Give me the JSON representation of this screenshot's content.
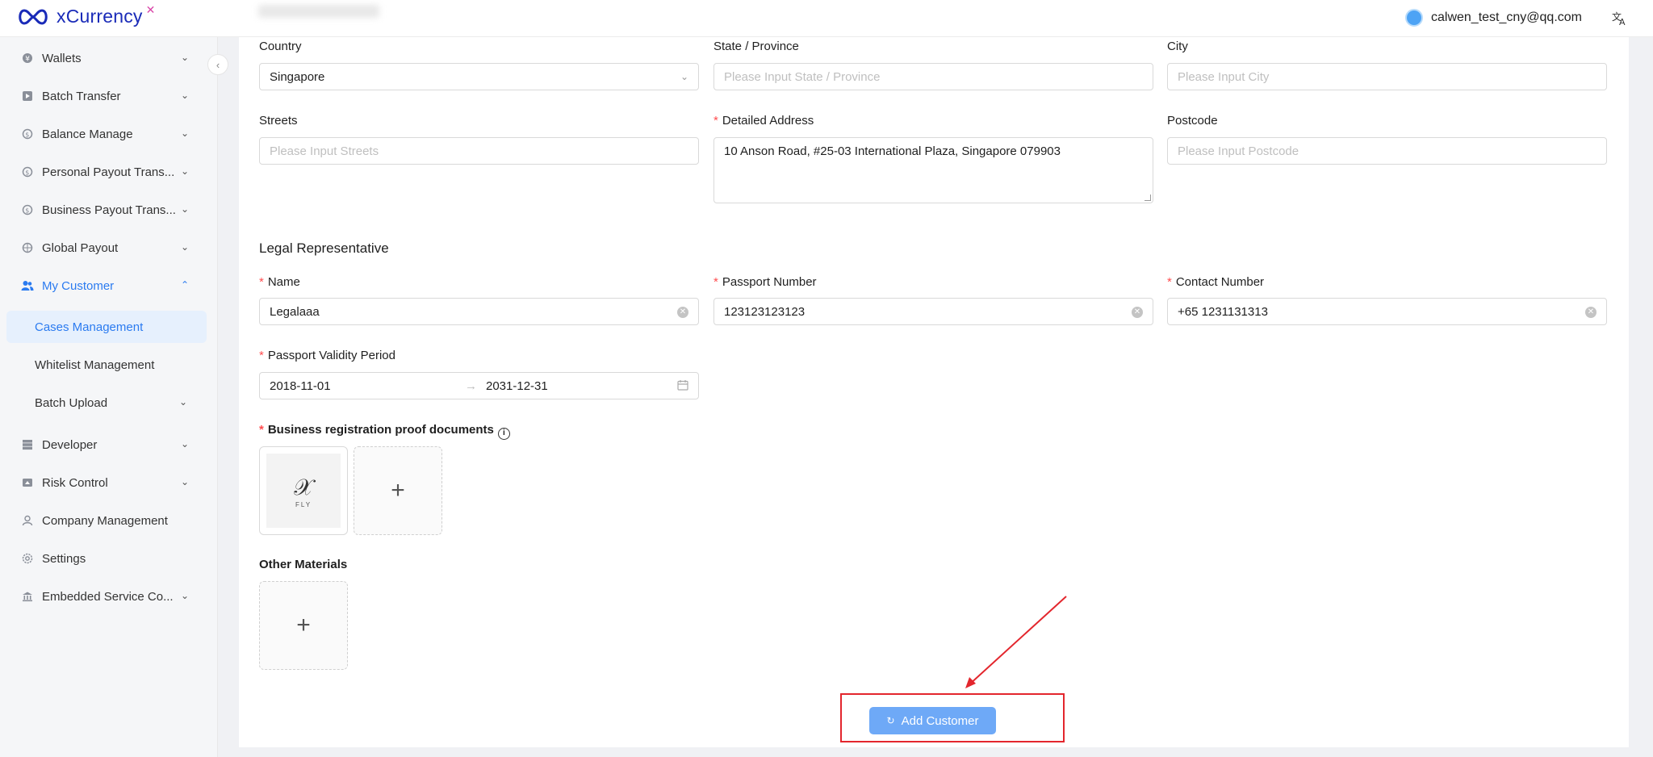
{
  "brand": {
    "name": "xCurrency"
  },
  "header": {
    "user_email": "calwen_test_cny@qq.com"
  },
  "sidebar": {
    "items": [
      {
        "label": "Wallets"
      },
      {
        "label": "Batch Transfer"
      },
      {
        "label": "Balance Manage"
      },
      {
        "label": "Personal Payout Trans..."
      },
      {
        "label": "Business Payout Trans..."
      },
      {
        "label": "Global Payout"
      },
      {
        "label": "My Customer"
      },
      {
        "label": "Cases Management"
      },
      {
        "label": "Whitelist Management"
      },
      {
        "label": "Batch Upload"
      },
      {
        "label": "Developer"
      },
      {
        "label": "Risk Control"
      },
      {
        "label": "Company Management"
      },
      {
        "label": "Settings"
      },
      {
        "label": "Embedded Service Co..."
      }
    ]
  },
  "address": {
    "country_label": "Country",
    "country_value": "Singapore",
    "state_label": "State / Province",
    "state_placeholder": "Please Input State / Province",
    "city_label": "City",
    "city_placeholder": "Please Input City",
    "streets_label": "Streets",
    "streets_placeholder": "Please Input Streets",
    "detailed_label": "Detailed Address",
    "detailed_value": "10 Anson Road, #25-03 International Plaza, Singapore 079903",
    "postcode_label": "Postcode",
    "postcode_placeholder": "Please Input Postcode"
  },
  "legal": {
    "section_title": "Legal Representative",
    "name_label": "Name",
    "name_value": "Legalaaa",
    "passport_label": "Passport Number",
    "passport_value": "123123123123",
    "contact_label": "Contact Number",
    "contact_value": "+65 1231131313",
    "validity_label": "Passport Validity Period",
    "validity_start": "2018-11-01",
    "validity_end": "2031-12-31"
  },
  "documents": {
    "proof_label": "Business registration proof documents",
    "thumb_caption": "FLY",
    "other_label": "Other Materials"
  },
  "actions": {
    "submit_label": "Add Customer"
  },
  "colors": {
    "primary": "#2b7bf0",
    "annotation": "#e3262d",
    "required": "#ff4d4f"
  }
}
